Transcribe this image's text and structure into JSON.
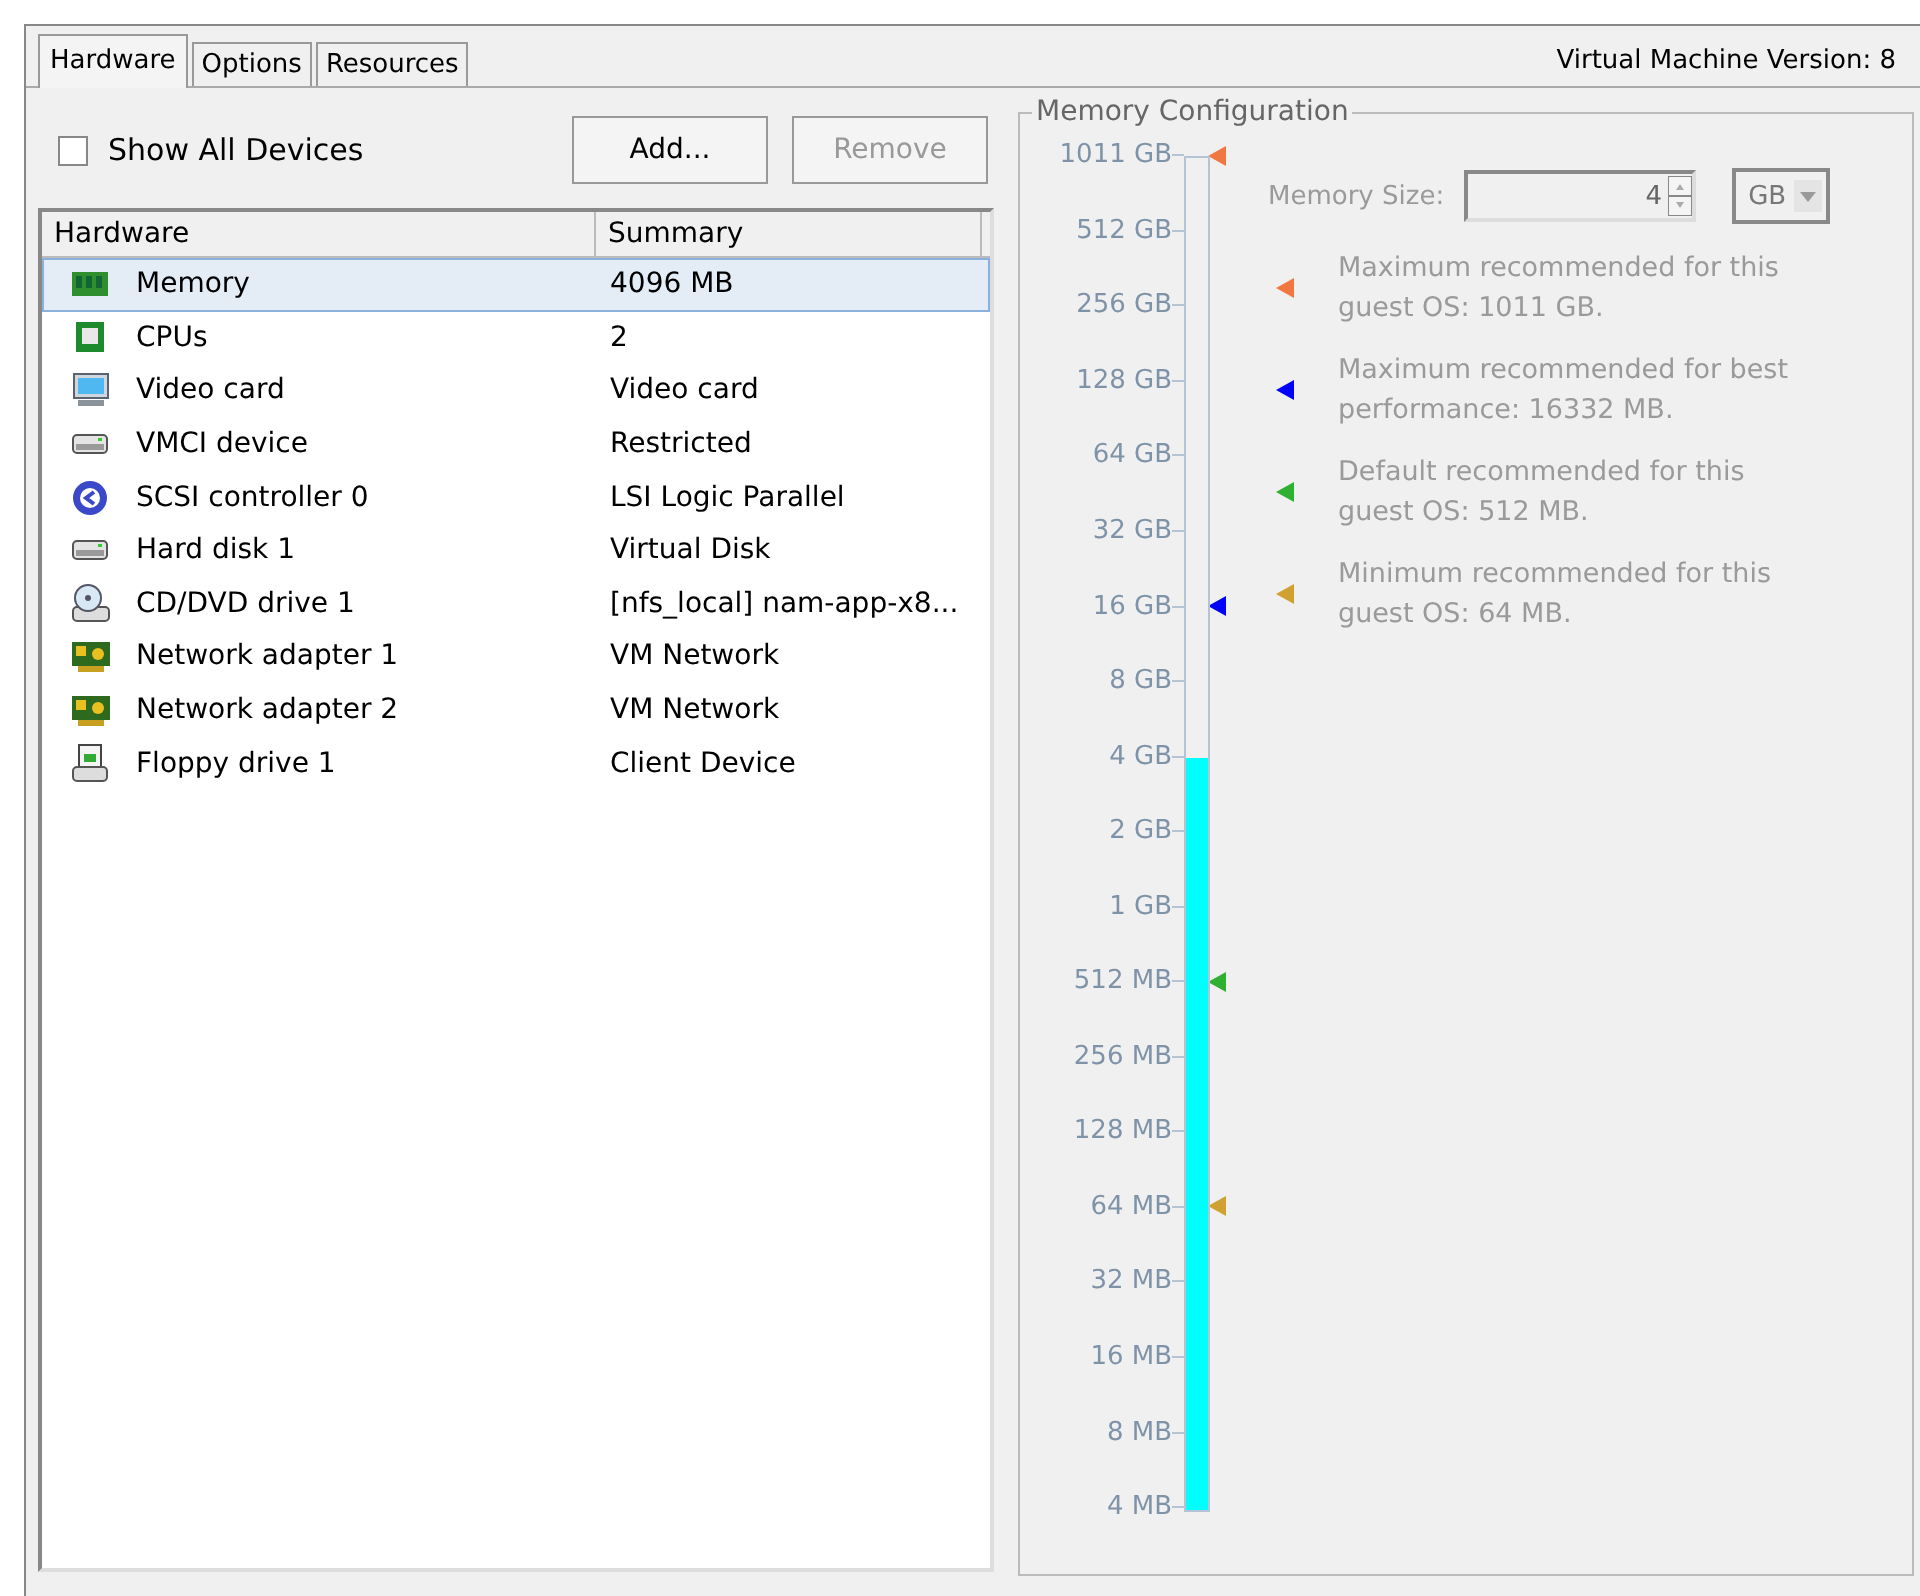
{
  "tabs": [
    {
      "label": "Hardware",
      "selected": true
    },
    {
      "label": "Options",
      "selected": false
    },
    {
      "label": "Resources",
      "selected": false
    }
  ],
  "version_label": "Virtual Machine Version: 8",
  "show_all_devices": {
    "label": "Show All Devices",
    "checked": false
  },
  "buttons": [
    {
      "label": "Add...",
      "disabled": false
    },
    {
      "label": "Remove",
      "disabled": true
    }
  ],
  "table": {
    "columns": [
      "Hardware",
      "Summary"
    ],
    "rows": [
      {
        "kind": "memory",
        "name": "Memory",
        "summary": "4096 MB",
        "selected": true
      },
      {
        "kind": "cpu",
        "name": "CPUs",
        "summary": "2",
        "selected": false
      },
      {
        "kind": "display",
        "name": "Video card",
        "summary": "Video card",
        "selected": false
      },
      {
        "kind": "drive",
        "name": "VMCI device",
        "summary": "Restricted",
        "selected": false
      },
      {
        "kind": "scsi",
        "name": "SCSI controller 0",
        "summary": "LSI Logic Parallel",
        "selected": false
      },
      {
        "kind": "drive",
        "name": "Hard disk 1",
        "summary": "Virtual Disk",
        "selected": false
      },
      {
        "kind": "cdrom",
        "name": "CD/DVD drive 1",
        "summary": "[nfs_local] nam-app-x8...",
        "selected": false
      },
      {
        "kind": "network",
        "name": "Network adapter 1",
        "summary": "VM Network",
        "selected": false
      },
      {
        "kind": "network",
        "name": "Network adapter 2",
        "summary": "VM Network",
        "selected": false
      },
      {
        "kind": "floppy",
        "name": "Floppy drive 1",
        "summary": "Client Device",
        "selected": false
      }
    ]
  },
  "memory_configuration": {
    "title": "Memory Configuration",
    "disabled": true,
    "slider": {
      "level": 0.556,
      "ticks": [
        {
          "label": "1011 GB",
          "color": "#f07840"
        },
        {
          "label": "512 GB"
        },
        {
          "label": "256 GB"
        },
        {
          "label": "128 GB"
        },
        {
          "label": "64 GB"
        },
        {
          "label": "32 GB"
        },
        {
          "label": "16 GB",
          "color": "#0000ff"
        },
        {
          "label": "8 GB"
        },
        {
          "label": "4 GB"
        },
        {
          "label": "2 GB"
        },
        {
          "label": "1 GB"
        },
        {
          "label": "512 MB",
          "color": "#30b030"
        },
        {
          "label": "256 MB"
        },
        {
          "label": "128 MB"
        },
        {
          "label": "64 MB",
          "color": "#d0a030"
        },
        {
          "label": "32 MB"
        },
        {
          "label": "16 MB"
        },
        {
          "label": "8 MB"
        },
        {
          "label": "4 MB"
        }
      ]
    },
    "size_label": "Memory Size:",
    "size_value": "4",
    "unit": "GB",
    "legend": [
      {
        "color": "#f07840",
        "text": "Maximum recommended for this guest OS: 1011 GB."
      },
      {
        "color": "#0000ff",
        "text": "Maximum recommended for best performance: 16332 MB."
      },
      {
        "color": "#30b030",
        "text": "Default recommended for this guest OS: 512 MB."
      },
      {
        "color": "#d0a030",
        "text": "Minimum recommended for this guest OS: 64 MB."
      }
    ]
  }
}
